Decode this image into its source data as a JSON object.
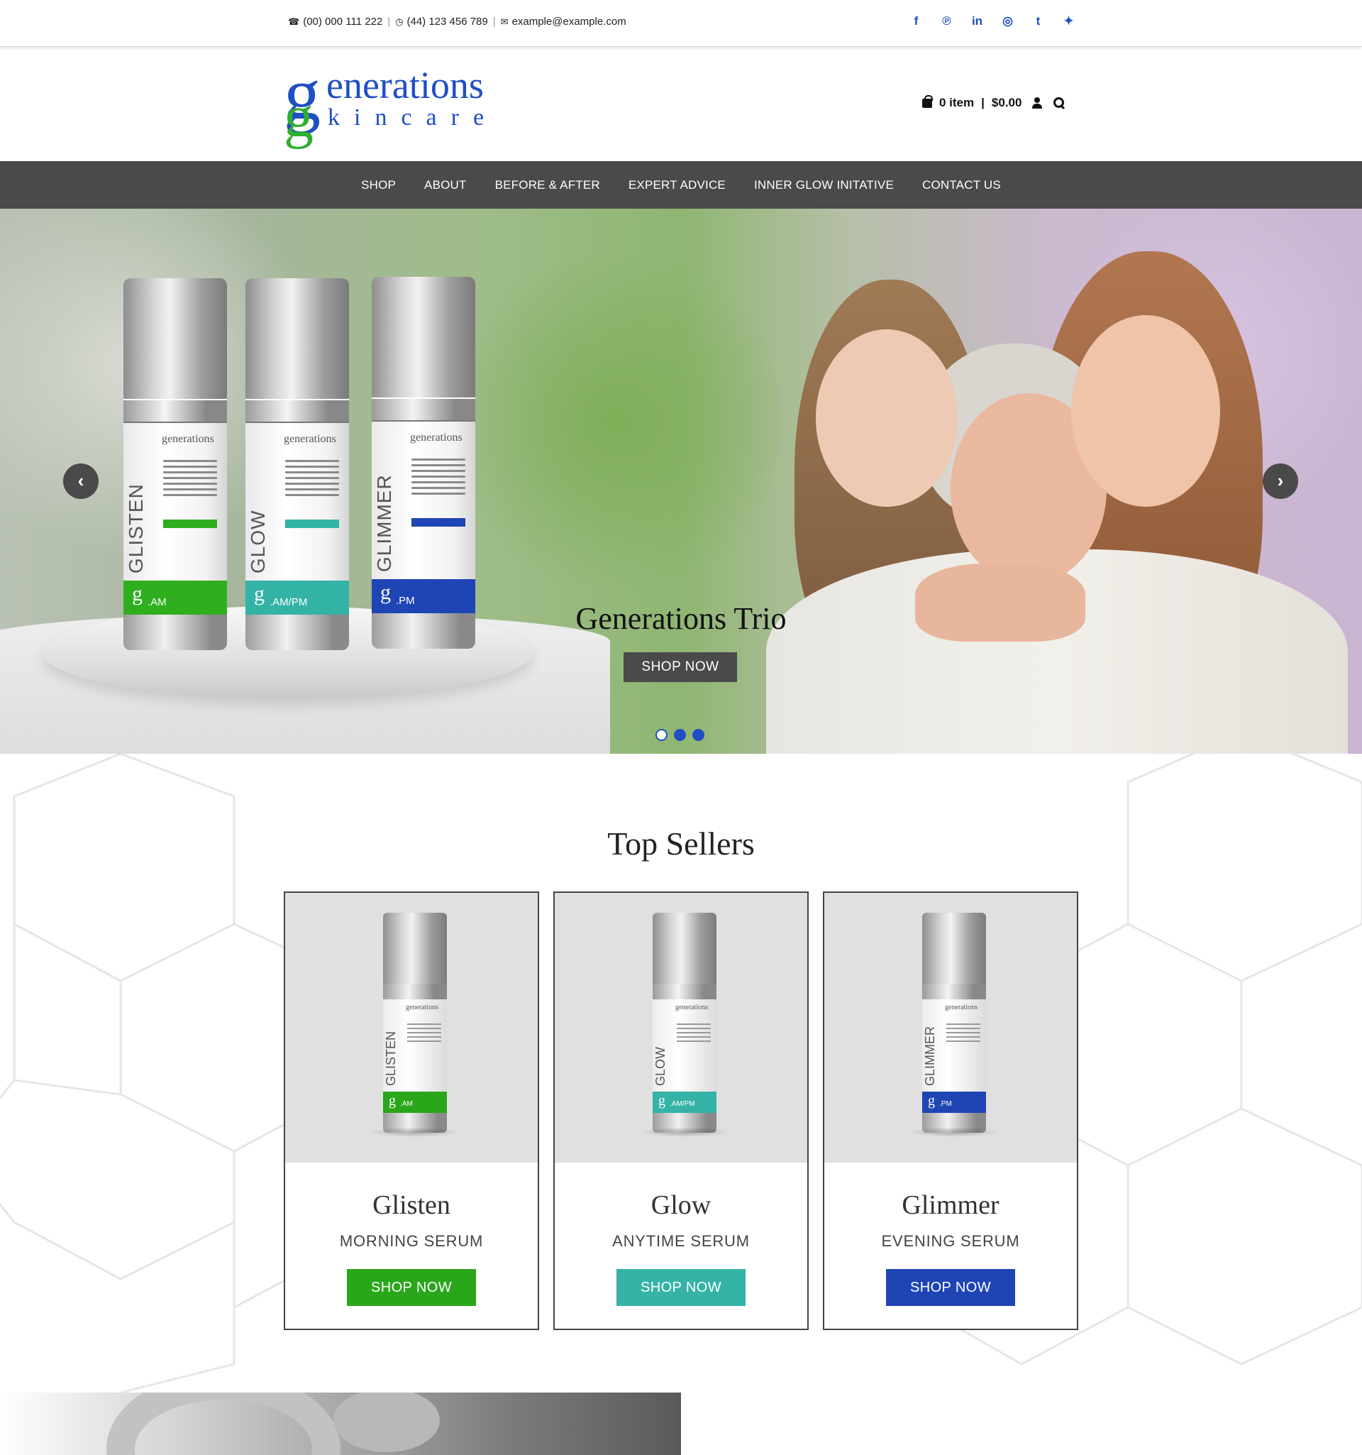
{
  "topbar": {
    "phone1": "(00) 000 111 222",
    "phone2": "(44) 123 456 789",
    "email": "example@example.com",
    "socials": [
      {
        "name": "facebook-icon",
        "glyph": "f"
      },
      {
        "name": "pinterest-icon",
        "glyph": "p"
      },
      {
        "name": "linkedin-icon",
        "glyph": "in"
      },
      {
        "name": "instagram-icon",
        "glyph": "◎"
      },
      {
        "name": "tumblr-icon",
        "glyph": "t"
      },
      {
        "name": "twitter-icon",
        "glyph": "🐦"
      }
    ]
  },
  "logo": {
    "line1": "enerations",
    "line2": "kincare"
  },
  "cart": {
    "items": "0 item",
    "separator": "|",
    "total": "$0.00"
  },
  "nav": {
    "items": [
      "SHOP",
      "ABOUT",
      "BEFORE & AFTER",
      "EXPERT ADVICE",
      "INNER GLOW INITATIVE",
      "CONTACT US"
    ]
  },
  "hero": {
    "title": "Generations Trio",
    "button": "SHOP NOW",
    "prev": "‹",
    "next": "›",
    "bottles": [
      {
        "name": "GLISTEN",
        "band": "g",
        "band_sub": ".AM",
        "color": "#2fae1f"
      },
      {
        "name": "GLOW",
        "band": "g",
        "band_sub": ".AM/PM",
        "color": "#33b3a6"
      },
      {
        "name": "GLIMMER",
        "band": "g",
        "band_sub": ".PM",
        "color": "#1f45b5"
      }
    ],
    "bottle_brand": "generations"
  },
  "sellers": {
    "title": "Top Sellers",
    "cards": [
      {
        "name": "Glisten",
        "sub": "MORNING SERUM",
        "button": "SHOP NOW",
        "color": "#2aa61a",
        "vname": "GLISTEN",
        "band_sub": ".AM"
      },
      {
        "name": "Glow",
        "sub": "ANYTIME SERUM",
        "button": "SHOP NOW",
        "color": "#34b3a6",
        "vname": "GLOW",
        "band_sub": ".AM/PM"
      },
      {
        "name": "Glimmer",
        "sub": "EVENING SERUM",
        "button": "SHOP NOW",
        "color": "#1f45b5",
        "vname": "GLIMMER",
        "band_sub": ".PM"
      }
    ]
  },
  "colors": {
    "brand_blue": "#1f4fc4",
    "brand_green": "#2fae2f",
    "nav_bg": "#4a4a4a"
  }
}
